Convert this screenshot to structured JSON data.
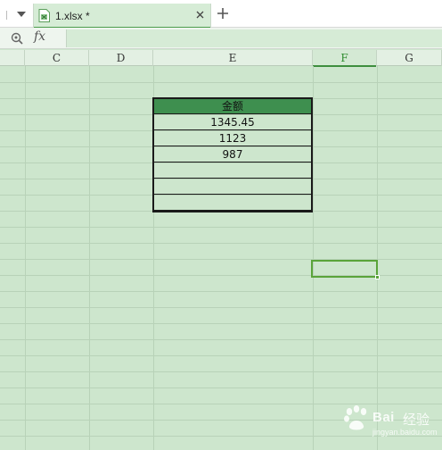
{
  "tabs": [
    {
      "label": "1.xlsx *"
    }
  ],
  "formula_bar": {
    "fx_label": "fx",
    "value": ""
  },
  "columns": [
    "C",
    "D",
    "E",
    "F",
    "G"
  ],
  "active_column": "F",
  "table": {
    "header": "金额",
    "values": [
      "1345.45",
      "1123",
      "987",
      "",
      "",
      ""
    ]
  },
  "watermark": {
    "brand": "Bai",
    "suffix": "经验",
    "url": "jingyan.baidu.com"
  },
  "colors": {
    "sheet_background": "#cde6cd",
    "header_fill": "#3e8f4f",
    "selection": "#5aa43a"
  },
  "icons": [
    "dropdown-arrow-icon",
    "spreadsheet-file-icon",
    "close-icon",
    "plus-icon",
    "zoom-icon"
  ]
}
